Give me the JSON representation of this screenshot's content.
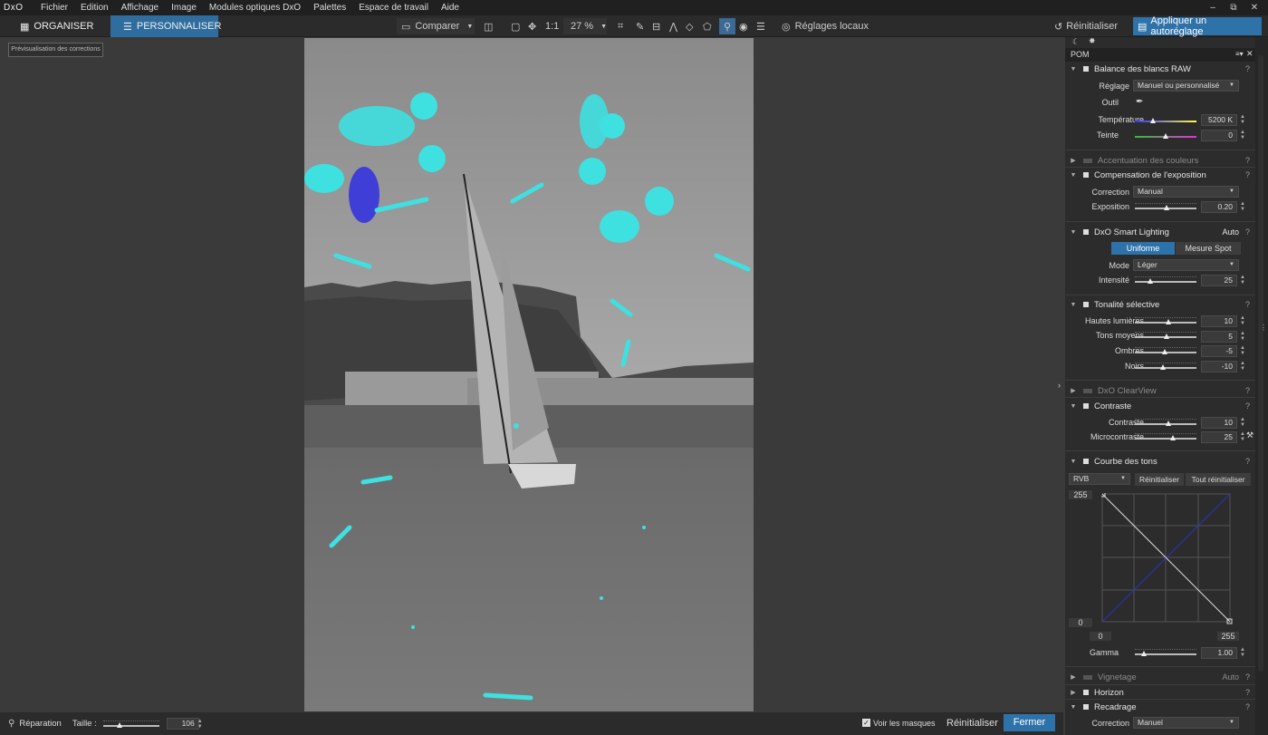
{
  "menubar": {
    "logo": "DxO",
    "items": [
      "Fichier",
      "Edition",
      "Affichage",
      "Image",
      "Modules optiques DxO",
      "Palettes",
      "Espace de travail",
      "Aide"
    ],
    "win_min": "‒",
    "win_max": "⧉",
    "win_close": "✕"
  },
  "toolbar": {
    "organiser": "ORGANISER",
    "personnaliser": "PERSONNALISER",
    "comparer": "Comparer",
    "ratio": "1:1",
    "zoom": "27 %",
    "reglages_locaux": "Réglages locaux",
    "reinitialiser": "Réinitialiser",
    "appliquer": "Appliquer un autoréglage"
  },
  "preview_label": "Prévisualisation des corrections",
  "bottom": {
    "reparation": "Réparation",
    "taille_label": "Taille :",
    "taille_value": "106",
    "taille_fraction": 0.3,
    "voir_masques": "Voir les masques",
    "reinitialiser": "Réinitialiser",
    "fermer": "Fermer"
  },
  "panel": {
    "pom": "POM",
    "wb": {
      "title": "Balance des blancs RAW",
      "reglage_label": "Réglage",
      "reglage_value": "Manuel ou personnalisé",
      "outil_label": "Outil",
      "temp_label": "Température",
      "temp_value": "5200 K",
      "teinte_label": "Teinte",
      "teinte_value": "0"
    },
    "accent": {
      "title": "Accentuation des couleurs"
    },
    "expo": {
      "title": "Compensation de l'exposition",
      "correction_label": "Correction",
      "correction_value": "Manual",
      "exposition_label": "Exposition",
      "exposition_value": "0.20"
    },
    "smart": {
      "title": "DxO Smart Lighting",
      "auto": "Auto",
      "uniforme": "Uniforme",
      "spot": "Mesure Spot",
      "mode_label": "Mode",
      "mode_value": "Léger",
      "intensite_label": "Intensité",
      "intensite_value": "25"
    },
    "tonalite": {
      "title": "Tonalité sélective",
      "hl_label": "Hautes lumières",
      "hl_value": "10",
      "tm_label": "Tons moyens",
      "tm_value": "5",
      "om_label": "Ombres",
      "om_value": "-5",
      "noirs_label": "Noirs",
      "noirs_value": "-10"
    },
    "clearview": {
      "title": "DxO ClearView"
    },
    "contraste": {
      "title": "Contraste",
      "c_label": "Contraste",
      "c_value": "10",
      "mc_label": "Microcontraste",
      "mc_value": "25"
    },
    "courbe": {
      "title": "Courbe des tons",
      "channel": "RVB",
      "reinit": "Réinitialiser",
      "tout": "Tout réinitialiser",
      "y_max": "255",
      "y_min": "0",
      "x_min": "0",
      "x_max": "255",
      "gamma_label": "Gamma",
      "gamma_value": "1.00"
    },
    "vignetage": {
      "title": "Vignetage",
      "auto": "Auto"
    },
    "horizon": {
      "title": "Horizon"
    },
    "recadrage": {
      "title": "Recadrage",
      "correction_label": "Correction",
      "correction_value": "Manuel"
    },
    "help": "?"
  },
  "colors": {
    "accent": "#2f6d9e",
    "mask": "#3ee0e0",
    "mask_selected": "#3f3fd8"
  }
}
